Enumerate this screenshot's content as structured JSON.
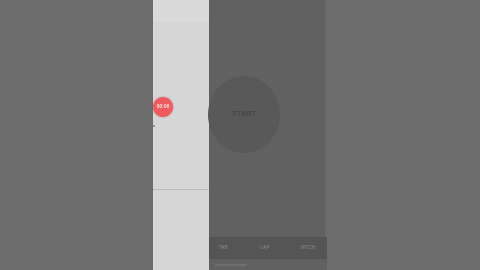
{
  "timer_badge": "00:00",
  "start_button": "START",
  "bottom_tabs": [
    "TAB",
    "LAP",
    "WTCH"
  ],
  "colors": {
    "overlay": "#616161",
    "drawer": "#d6d6d6",
    "badge": "#f05a5e"
  }
}
